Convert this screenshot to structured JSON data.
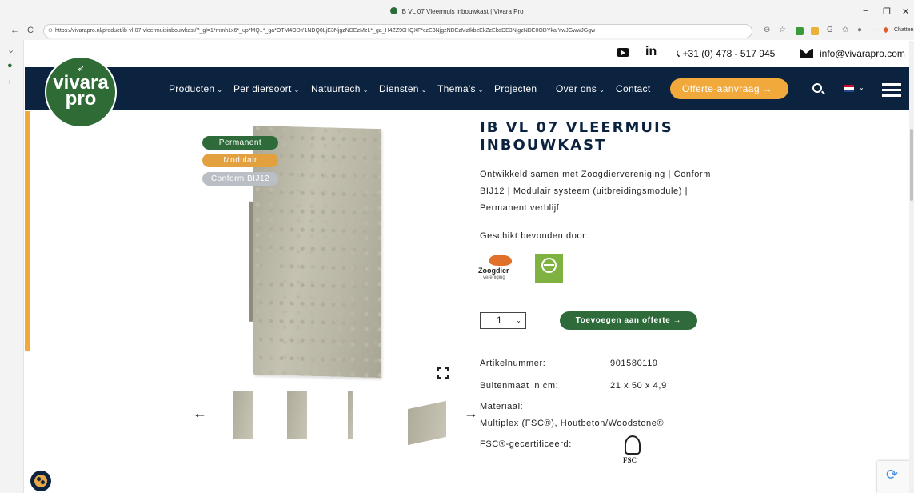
{
  "browser": {
    "tab_title": "IB VL 07 Vleermuis inbouwkast | Vivara Pro",
    "url": "https://vivarapro.nl/product/ib-vl-07-vleermuisinbouwkast/?_gl=1*mmh1x6*_up*MQ..*_ga*OTM4ODY1NDQ0LjE3NjgzNDEzMzI.*_ga_H4ZZ90HQXF*czE3NjgzNDEzMzIkbzEkZzEkdDE3NjgzNDE0ODYkajYwJGwwJGgw",
    "minimize": "−",
    "restore": "❐",
    "close": "✕",
    "back": "←",
    "reload": "C",
    "ext_more": "···",
    "profile_label": "Chatten"
  },
  "contact": {
    "phone": "+31 (0) 478 - 517 945",
    "email": "info@vivarapro.com",
    "linkedin": "in"
  },
  "logo": {
    "line1": "vivara",
    "line2": "pro"
  },
  "nav": {
    "items": [
      {
        "label": "Producten",
        "chev": "⌄"
      },
      {
        "label": "Per diersoort",
        "chev": "⌄"
      },
      {
        "label": "Natuurtech",
        "chev": "⌄"
      },
      {
        "label": "Diensten",
        "chev": "⌄"
      },
      {
        "label": "Thema's",
        "chev": "⌄"
      },
      {
        "label": "Projecten",
        "chev": ""
      },
      {
        "label": "Over ons",
        "chev": "⌄"
      },
      {
        "label": "Contact",
        "chev": ""
      }
    ],
    "offerte_button": "Offerte-aanvraag  →",
    "lang_chev": "⌄"
  },
  "tags": [
    {
      "label": "Permanent",
      "color": "#2f6b3a"
    },
    {
      "label": "Modulair",
      "color": "#e2a03f"
    },
    {
      "label": "Conform BIJ12",
      "color": "#b9bfc4"
    }
  ],
  "gallery": {
    "prev": "←",
    "next": "→"
  },
  "product": {
    "title": "IB VL 07 VLEERMUIS INBOUWKAST",
    "description": "Ontwikkeld samen met Zoogdiervereniging | Conform BIJ12 | Modulair systeem (uitbreidingsmodule) | Permanent verblijf",
    "suitable_label": "Geschikt bevonden door:",
    "partner1_name": "Zoogdier",
    "partner1_sub": "vereniging",
    "quantity": "1",
    "quantity_chev": "⌄",
    "add_button": "Toevoegen aan offerte  →",
    "specs": {
      "article_label": "Artikelnummer:",
      "article_value": "901580119",
      "size_label": "Buitenmaat in cm:",
      "size_value": "21 x 50 x 4,9",
      "material_label": "Materiaal:",
      "material_value": "Multiplex (FSC®), Houtbeton/Woodstone®",
      "fsc_label": "FSC®-gecertificeerd:",
      "fsc_logo": "FSC"
    }
  },
  "colors": {
    "navy": "#0c2340",
    "green": "#2f6b3a",
    "orange": "#f0a93a"
  }
}
